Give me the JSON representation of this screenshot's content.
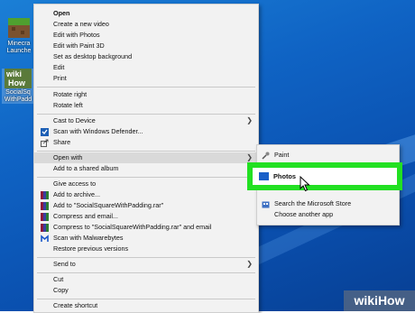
{
  "desktop": {
    "icons": [
      {
        "label": "Minecraf Launche",
        "line1": "Minecra",
        "line2": "Launche"
      },
      {
        "label": "SocialSquareWithPadding",
        "line1": "SocialSq",
        "line2": "WithPadd",
        "logo_text_1": "wiki",
        "logo_text_2": "How"
      }
    ]
  },
  "context_menu": {
    "items": [
      {
        "label": "Open",
        "bold": true
      },
      {
        "label": "Create a new video"
      },
      {
        "label": "Edit with Photos"
      },
      {
        "label": "Edit with Paint 3D"
      },
      {
        "label": "Set as desktop background"
      },
      {
        "label": "Edit"
      },
      {
        "label": "Print"
      },
      {
        "label": "Rotate right"
      },
      {
        "label": "Rotate left"
      },
      {
        "label": "Cast to Device"
      },
      {
        "label": "Scan with Windows Defender..."
      },
      {
        "label": "Share"
      },
      {
        "label": "Open with"
      },
      {
        "label": "Add to a shared album"
      },
      {
        "label": "Give access to"
      },
      {
        "label": "Add to archive..."
      },
      {
        "label": "Add to \"SocialSquareWithPadding.rar\""
      },
      {
        "label": "Compress and email..."
      },
      {
        "label": "Compress to \"SocialSquareWithPadding.rar\" and email"
      },
      {
        "label": "Scan with Malwarebytes"
      },
      {
        "label": "Restore previous versions"
      },
      {
        "label": "Send to"
      },
      {
        "label": "Cut"
      },
      {
        "label": "Copy"
      },
      {
        "label": "Create shortcut"
      }
    ]
  },
  "open_with_submenu": {
    "items": [
      {
        "label": "Paint"
      },
      {
        "label": "Photos"
      },
      {
        "label": "Search the Microsoft Store"
      },
      {
        "label": "Choose another app"
      }
    ]
  },
  "colors": {
    "desktop_blue": "#0f63c4",
    "highlight_green": "#22e022",
    "menu_bg": "#f2f2f2"
  },
  "watermark": {
    "text": "wikiHow"
  }
}
